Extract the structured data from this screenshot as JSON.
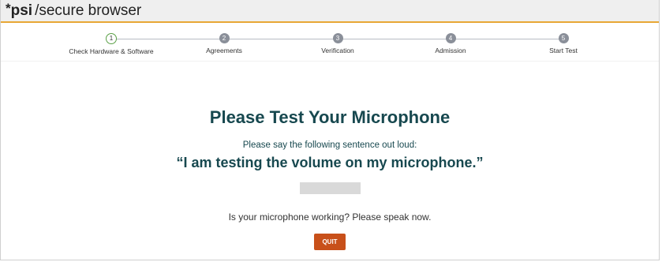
{
  "app": {
    "star": "*",
    "brand": "psi",
    "title_rest": "/secure browser"
  },
  "steps": [
    {
      "number": "1",
      "label": "Check Hardware & Software",
      "state": "active"
    },
    {
      "number": "2",
      "label": "Agreements",
      "state": "pending"
    },
    {
      "number": "3",
      "label": "Verification",
      "state": "pending"
    },
    {
      "number": "4",
      "label": "Admission",
      "state": "pending"
    },
    {
      "number": "5",
      "label": "Start Test",
      "state": "pending"
    }
  ],
  "main": {
    "heading": "Please Test Your Microphone",
    "instruction": "Please say the following sentence out loud:",
    "sentence": "“I am testing the volume on my microphone.”",
    "question": "Is your microphone working? Please speak now.",
    "quit_label": "QUIT",
    "mic_level": 0
  },
  "colors": {
    "accent": "#e8a735",
    "heading": "#17484f",
    "quit": "#c8501a",
    "step_active": "#5aa046",
    "step_pending": "#8a8f99"
  }
}
